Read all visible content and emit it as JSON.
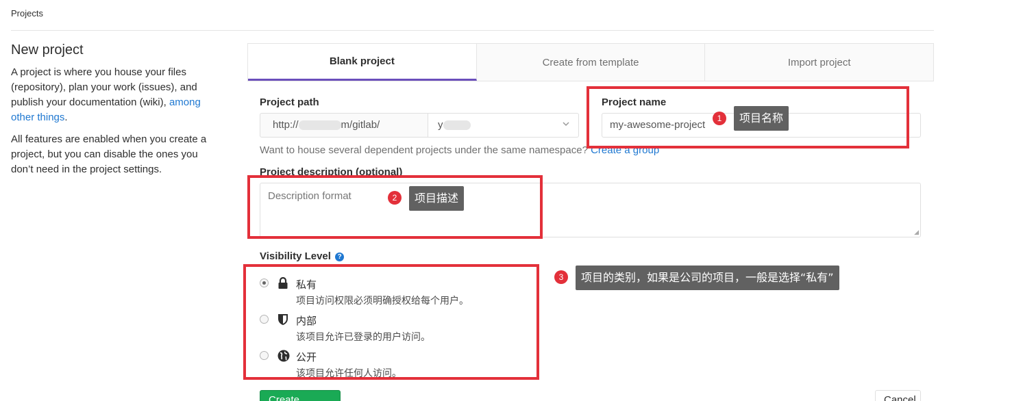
{
  "breadcrumb": "Projects",
  "sidebar": {
    "title": "New project",
    "para1_text": "A project is where you house your files (repository), plan your work (issues), and publish your documentation (wiki),",
    "para1_link": "among other things",
    "para1_end": ".",
    "para2": "All features are enabled when you create a project, but you can disable the ones you don’t need in the project settings."
  },
  "tabs": [
    {
      "label": "Blank project",
      "active": true
    },
    {
      "label": "Create from template",
      "active": false
    },
    {
      "label": "Import project",
      "active": false
    }
  ],
  "form": {
    "path_label": "Project path",
    "path_prefix_start": "http://",
    "path_prefix_end": "m/gitlab/",
    "namespace_value": "y",
    "name_label": "Project name",
    "name_placeholder": "my-awesome-project",
    "help_text": "Want to house several dependent projects under the same namespace?",
    "help_link": "Create a group",
    "description_label": "Project description (optional)",
    "description_placeholder": "Description format",
    "visibility_label": "Visibility Level",
    "visibility_options": [
      {
        "title": "私有",
        "description": "项目访问权限必须明确授权给每个用户。",
        "icon": "lock-icon",
        "checked": true
      },
      {
        "title": "内部",
        "description": "该项目允许已登录的用户访问。",
        "icon": "shield-icon",
        "checked": false
      },
      {
        "title": "公开",
        "description": "该项目允许任何人访问。",
        "icon": "globe-icon",
        "checked": false
      }
    ],
    "create_button": "Create project",
    "cancel_button": "Cancel"
  },
  "annotations": [
    {
      "number": "1",
      "text": "项目名称"
    },
    {
      "number": "2",
      "text": "项目描述"
    },
    {
      "number": "3",
      "text": "项目的类别，如果是公司的项目，一般是选择“私有”"
    }
  ],
  "colors": {
    "annotation_red": "#e3303a",
    "tooltip_gray": "#616161",
    "active_tab_underline": "#6b4fbb",
    "link_blue": "#1f78d1",
    "create_green": "#1aaa55"
  }
}
